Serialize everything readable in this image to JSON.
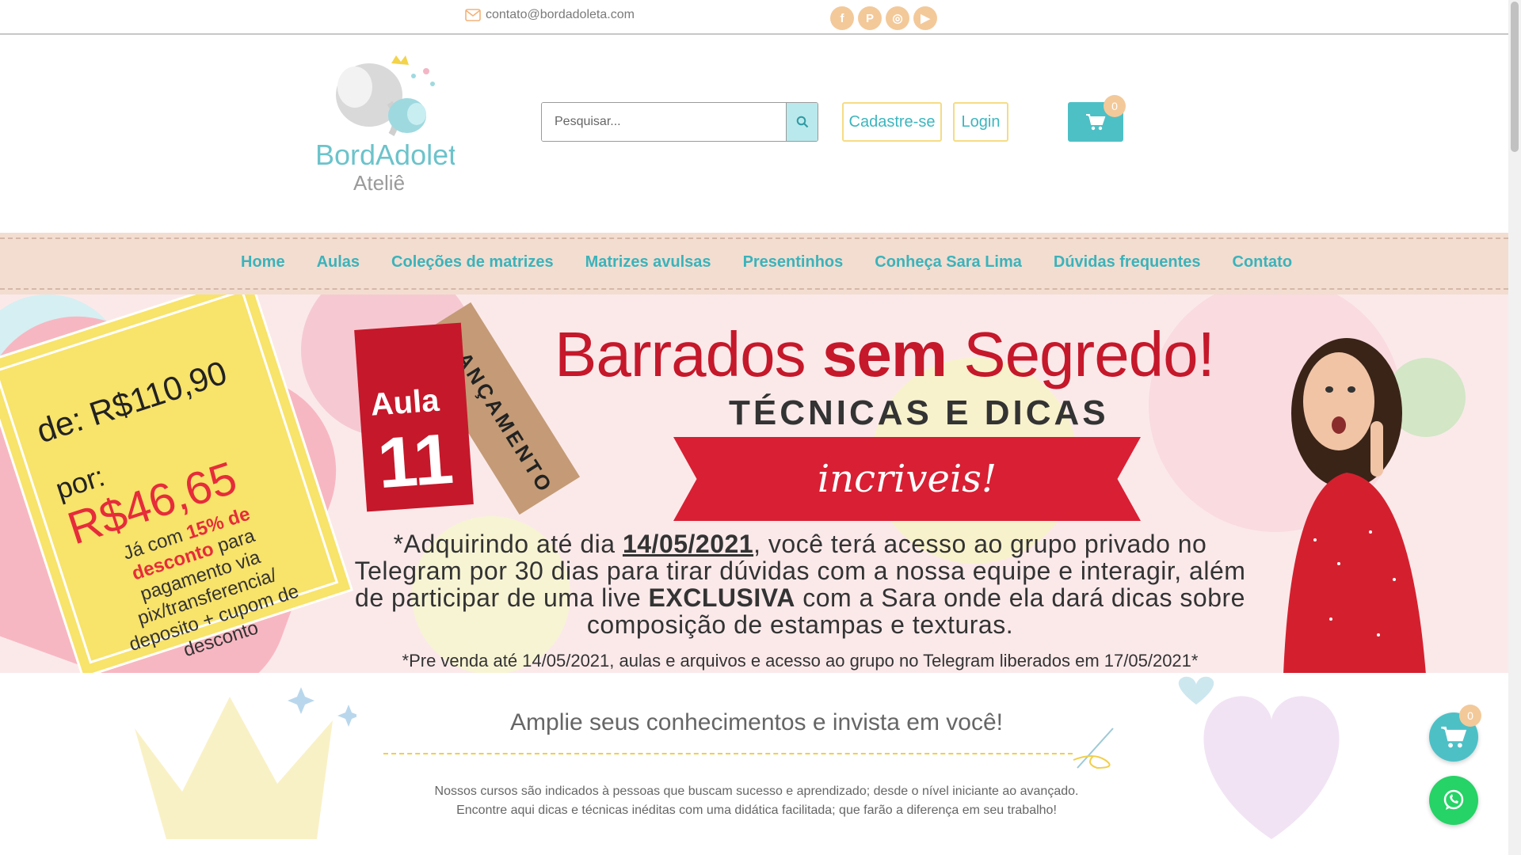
{
  "topbar": {
    "email": "contato@bordadoleta.com",
    "socials": [
      {
        "icon": "facebook-icon",
        "glyph": "f"
      },
      {
        "icon": "pinterest-icon",
        "glyph": "P"
      },
      {
        "icon": "instagram-icon",
        "glyph": "◎"
      },
      {
        "icon": "youtube-icon",
        "glyph": "▶"
      }
    ]
  },
  "header": {
    "logo_text_1": "BordAdoleta",
    "logo_text_2": "Ateliê",
    "search": {
      "placeholder": "Pesquisar..."
    },
    "register_label": "Cadastre-se",
    "login_label": "Login",
    "cart_count": "0"
  },
  "nav": {
    "items": [
      "Home",
      "Aulas",
      "Coleções de matrizes",
      "Matrizes avulsas",
      "Presentinhos",
      "Conheça Sara Lima",
      "Dúvidas frequentes",
      "Contato"
    ]
  },
  "banner": {
    "price_from_prefix": "de:",
    "price_from": "R$110,90",
    "price_to_prefix": "por:",
    "price_to": "R$46,65",
    "discount_pre": "Já com",
    "discount_highlight": "15% de desconto",
    "discount_post": "para pagamento via pix/transferencia/ deposito + cupom de desconto",
    "aula_label": "Aula",
    "aula_number": "11",
    "launch_label": "LANÇAMENTO",
    "title_1": "Barrados",
    "title_2": "sem",
    "title_3": "Segredo!",
    "subtitle": "TÉCNICAS E DICAS",
    "ribbon": "incriveis!",
    "body_pre": "*Adquirindo até dia",
    "body_date": "14/05/2021",
    "body_mid": ", você terá acesso ao grupo privado  no Telegram por 30 dias para tirar dúvidas com a nossa equipe e interagir, além de participar de uma live",
    "body_exclusive": "EXCLUSIVA",
    "body_post": "com a Sara onde ela dará dicas sobre composição de estampas e texturas.",
    "footnote": "*Pre venda até 14/05/2021, aulas e arquivos e acesso ao grupo no Telegram liberados em 17/05/2021*"
  },
  "section": {
    "title": "Amplie seus conhecimentos e invista em você!",
    "desc_1": "Nossos cursos são indicados à pessoas que buscam sucesso e aprendizado; desde o nível iniciante ao avançado.",
    "desc_2": "Encontre aqui dicas e técnicas inéditas com uma didática facilitada; que farão a diferença em seu trabalho!"
  },
  "floating": {
    "cart_count": "0"
  },
  "colors": {
    "brand_teal": "#3ab3bb",
    "accent_peach": "#f3c99a",
    "banner_red": "#c5182a",
    "whatsapp": "#25d366"
  }
}
